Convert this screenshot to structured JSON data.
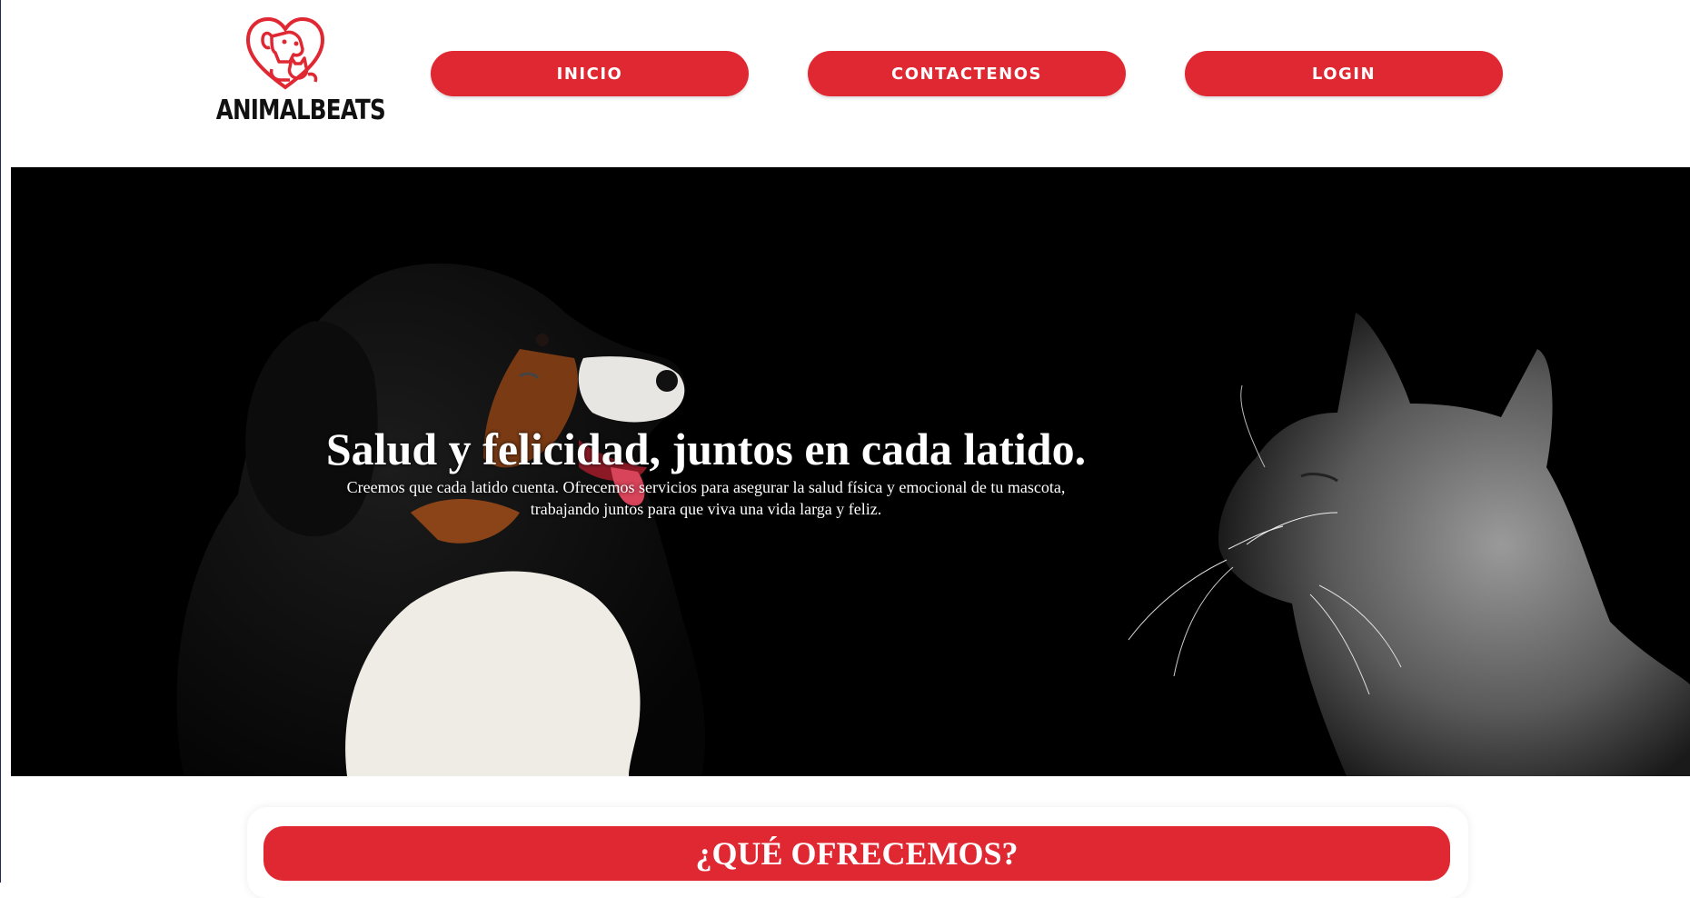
{
  "brand": {
    "name": "ANIMALBEATS",
    "logo_icon": "dog-cat-heart-icon",
    "accent_color": "#e02833"
  },
  "nav": {
    "items": [
      {
        "label": "INICIO"
      },
      {
        "label": "CONTACTENOS"
      },
      {
        "label": "LOGIN"
      }
    ]
  },
  "hero": {
    "title": "Salud y felicidad, juntos en cada latido.",
    "subtitle_line1": "Creemos que cada latido cuenta. Ofrecemos servicios para asegurar la salud física y emocional de tu mascota,",
    "subtitle_line2": "trabajando juntos para que viva una vida larga y feliz."
  },
  "offer": {
    "heading": "¿QUÉ OFRECEMOS?"
  }
}
